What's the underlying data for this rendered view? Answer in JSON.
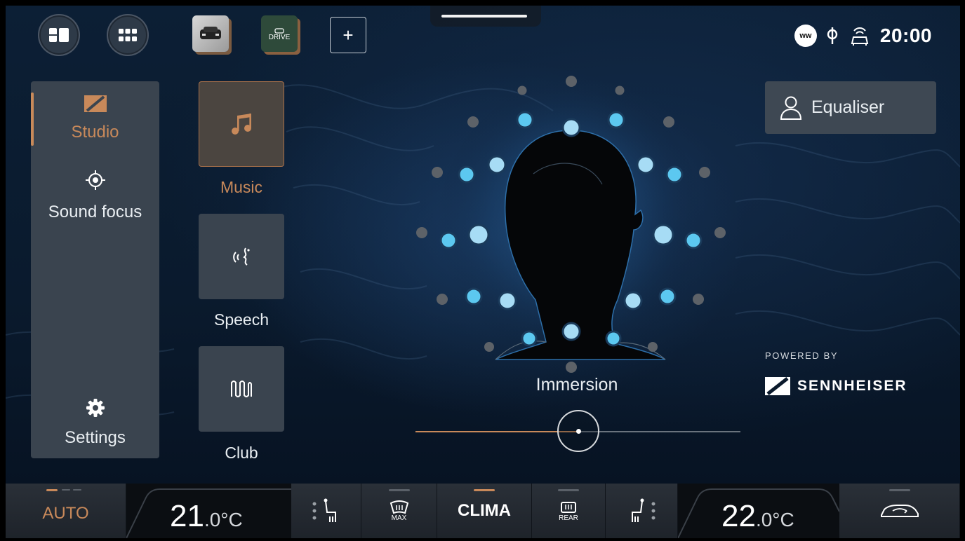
{
  "top_bar": {
    "apps": [
      {
        "name": "split-view"
      },
      {
        "name": "app-grid"
      },
      {
        "name": "vehicle"
      },
      {
        "name": "drive",
        "label": "DRIVE"
      }
    ],
    "add_label": "+",
    "status": {
      "ww_label": "ww",
      "time": "20:00"
    }
  },
  "sidebar": {
    "items": [
      {
        "label": "Studio",
        "icon": "sennheiser-icon",
        "active": true
      },
      {
        "label": "Sound focus",
        "icon": "target-icon",
        "active": false
      },
      {
        "label": "Settings",
        "icon": "gear-icon",
        "active": false
      }
    ]
  },
  "modes": [
    {
      "label": "Music",
      "icon": "music-note-icon",
      "active": true
    },
    {
      "label": "Speech",
      "icon": "speech-icon",
      "active": false
    },
    {
      "label": "Club",
      "icon": "wave-icon",
      "active": false
    }
  ],
  "immersion": {
    "label": "Immersion",
    "level": 0.5
  },
  "equaliser": {
    "label": "Equaliser"
  },
  "brand": {
    "powered_by": "POWERED BY",
    "name": "SENNHEISER"
  },
  "colors": {
    "accent": "#c8895a",
    "speaker_active": "#5cc8f0",
    "speaker_inactive": "#5d6268",
    "panel": "#3a444f"
  },
  "climate": {
    "auto_label": "AUTO",
    "left_temp_main": "21",
    "left_temp_dec": ".0°C",
    "max_label": "MAX",
    "clima_label": "CLIMA",
    "rear_label": "REAR",
    "right_temp_main": "22",
    "right_temp_dec": ".0°C"
  }
}
